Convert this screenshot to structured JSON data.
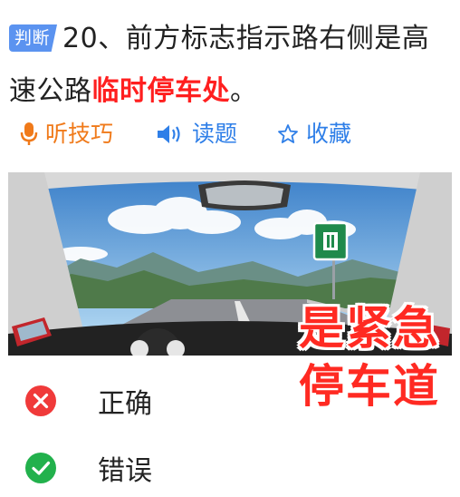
{
  "question": {
    "badge": "判断",
    "number": "20、",
    "text_line1": "前方标志指示路右侧是高",
    "text_line2": "速公路",
    "highlight": "临时停车处",
    "ending": "。"
  },
  "tools": {
    "listen_label": "听技巧",
    "read_label": "读题",
    "favorite_label": "收藏",
    "listen_icon": "microphone-icon",
    "read_icon": "speaker-icon",
    "favorite_icon": "star-icon"
  },
  "image_overlay": {
    "line1": "是紧急",
    "line2": "停车道"
  },
  "options": [
    {
      "label": "正确",
      "icon": "x-circle-icon",
      "color": "#f03a3a"
    },
    {
      "label": "错误",
      "icon": "check-circle-icon",
      "color": "#22b14c"
    }
  ],
  "colors": {
    "badge": "#5b93f0",
    "highlight": "#ff1f1f",
    "listen": "#f07a1a",
    "accent": "#2f7fe8",
    "stamp": "#ff2a22"
  }
}
